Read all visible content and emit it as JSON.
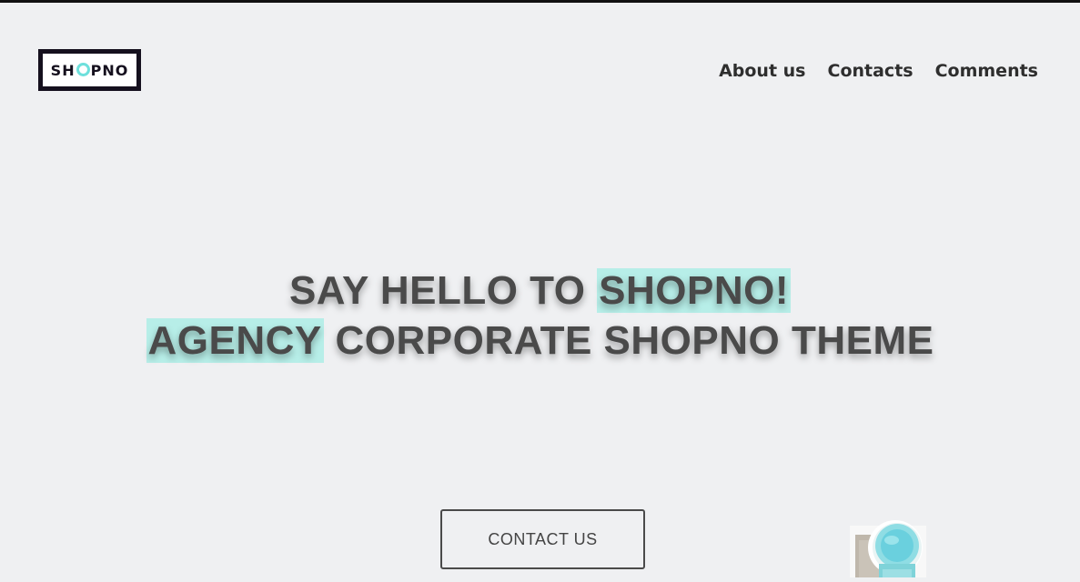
{
  "logo": {
    "text_before": "SH",
    "text_after": "PNO"
  },
  "nav": {
    "items": [
      {
        "label": "About us"
      },
      {
        "label": "Contacts"
      },
      {
        "label": "Comments"
      }
    ]
  },
  "hero": {
    "line1_plain": "SAY HELLO TO ",
    "line1_highlight": "SHOPNO!",
    "line2_highlight": "AGENCY",
    "line2_plain": " CORPORATE SHOPNO THEME"
  },
  "cta": {
    "label": "CONTACT US"
  },
  "colors": {
    "background": "#eff0f2",
    "accent": "#6ee0dc",
    "highlight": "#b7eee8",
    "text": "#4a4a4a",
    "logo_border": "#15101e"
  },
  "icons": {
    "logo_ring": "ring-o-icon",
    "product": "cup-product-image"
  }
}
